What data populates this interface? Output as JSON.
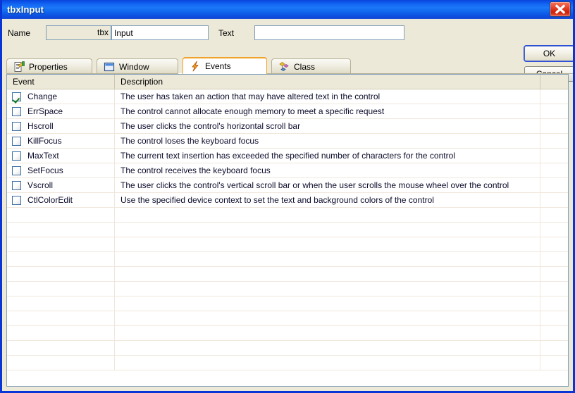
{
  "window": {
    "title": "tbxInput",
    "close_icon": "close-icon"
  },
  "form": {
    "name_label": "Name",
    "name_prefix_value": "tbx",
    "name_value": "Input",
    "text_label": "Text",
    "text_value": "",
    "text_placeholder": ""
  },
  "buttons": {
    "ok": "OK",
    "cancel": "Cancel"
  },
  "tabs": [
    {
      "label": "Properties",
      "icon": "properties-icon",
      "active": false
    },
    {
      "label": "Window",
      "icon": "window-icon",
      "active": false
    },
    {
      "label": "Events",
      "icon": "lightning-bolt-icon",
      "active": true
    },
    {
      "label": "Class",
      "icon": "class-diamond-icon",
      "active": false
    }
  ],
  "grid": {
    "headers": {
      "event": "Event",
      "description": "Description",
      "extra": ""
    },
    "rows": [
      {
        "checked": true,
        "event": "Change",
        "description": "The user has taken an action that may have altered text in the control"
      },
      {
        "checked": false,
        "event": "ErrSpace",
        "description": "The control cannot allocate enough memory to meet a specific request"
      },
      {
        "checked": false,
        "event": "Hscroll",
        "description": "The user clicks the control's horizontal scroll bar"
      },
      {
        "checked": false,
        "event": "KillFocus",
        "description": "The control loses the keyboard focus"
      },
      {
        "checked": false,
        "event": "MaxText",
        "description": "The current text insertion has exceeded the specified number of characters for the control"
      },
      {
        "checked": false,
        "event": "SetFocus",
        "description": "The control receives the keyboard focus"
      },
      {
        "checked": false,
        "event": "Vscroll",
        "description": "The user clicks the control's vertical scroll bar or when the user scrolls the mouse wheel over the control"
      },
      {
        "checked": false,
        "event": "CtlColorEdit",
        "description": "Use the specified device context to set the text and background colors of the control"
      }
    ],
    "empty_row_count": 11
  },
  "colors": {
    "titlebar_blue": "#1268ee",
    "frame_blue": "#0a35d6",
    "dialog_face": "#ece9d8",
    "active_tab_accent": "#f0a32b",
    "checkbox_border": "#3a6ea5",
    "check_green": "#157a22",
    "close_red": "#cf2008"
  }
}
